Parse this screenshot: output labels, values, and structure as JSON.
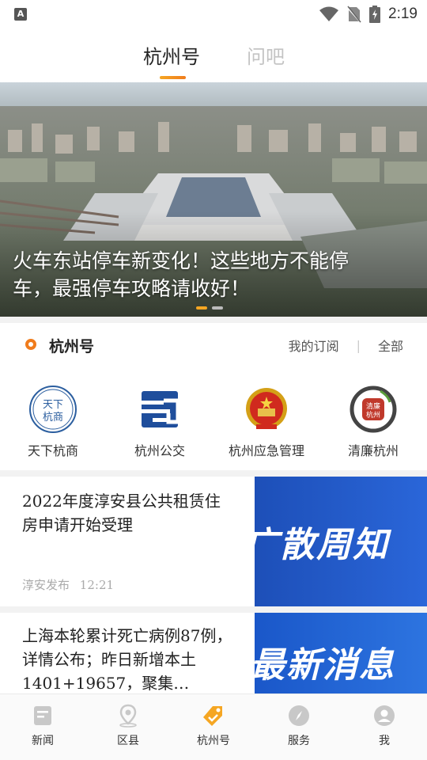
{
  "status_bar": {
    "notification_icon": "A",
    "time": "2:19"
  },
  "top_tabs": [
    {
      "label": "杭州号",
      "active": true
    },
    {
      "label": "问吧",
      "active": false
    }
  ],
  "banner": {
    "caption": "火车东站停车新变化！这些地方不能停车，最强停车攻略请收好！",
    "slide_count": 2,
    "active_slide": 1
  },
  "hangzhou_section": {
    "title": "杭州号",
    "my_subscriptions": "我的订阅",
    "separator": "|",
    "all": "全部",
    "channels": [
      {
        "label": "天下杭商",
        "logo_text": "天下杭商"
      },
      {
        "label": "杭州公交",
        "logo_text": ""
      },
      {
        "label": "杭州应急管理",
        "logo_text": ""
      },
      {
        "label": "清廉杭州",
        "logo_text": "清廉杭州"
      }
    ]
  },
  "news": [
    {
      "title": "2022年度淳安县公共租赁住房申请开始受理",
      "source": "淳安发布",
      "time": "12:21",
      "thumb_text": "广散周知"
    },
    {
      "title": "上海本轮累计死亡病例87例，详情公布；昨日新增本土1401+19657，聚集…",
      "thumb_text": "最新消息"
    }
  ],
  "bottom_nav": [
    {
      "label": "新闻",
      "icon": "news-icon",
      "active": false
    },
    {
      "label": "区县",
      "icon": "location-pin-icon",
      "active": false
    },
    {
      "label": "杭州号",
      "icon": "tag-icon",
      "active": true
    },
    {
      "label": "服务",
      "icon": "compass-icon",
      "active": false
    },
    {
      "label": "我",
      "icon": "user-icon",
      "active": false
    }
  ],
  "colors": {
    "accent": "#f5a623",
    "accent_dark": "#f07c1c",
    "inactive_tab": "#c4c4c4",
    "nav_icon_gray": "#c8c8c8",
    "thumb_blue": "#1f55c8"
  }
}
